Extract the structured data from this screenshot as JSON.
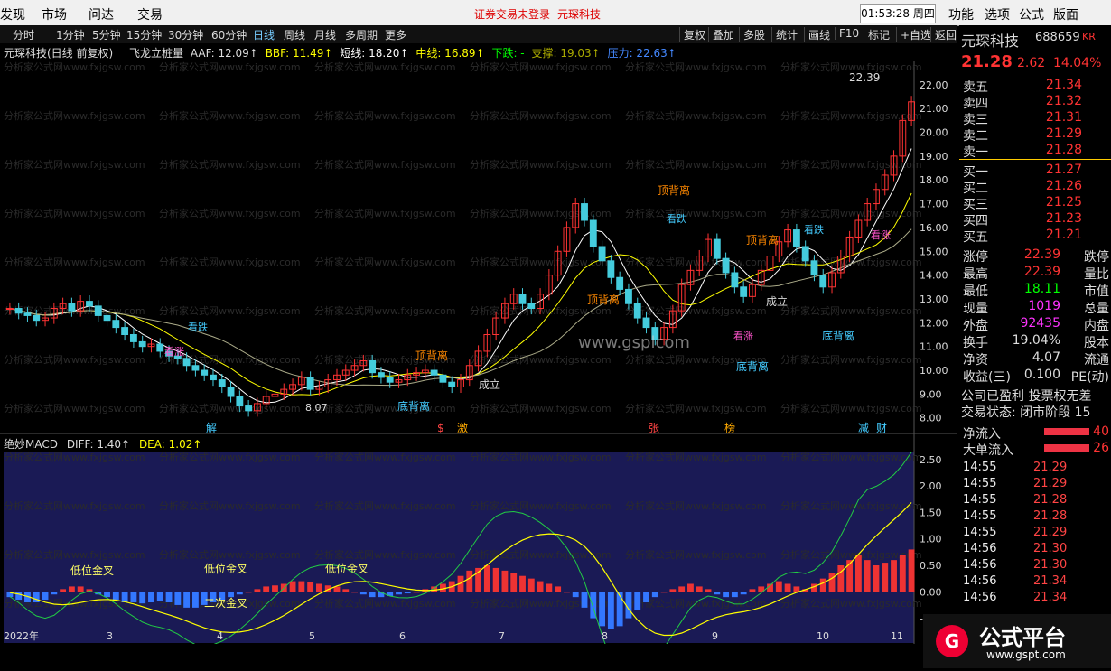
{
  "menubar": {
    "items": [
      "发现",
      "市场",
      "问达",
      "交易"
    ],
    "warning": "证券交易未登录",
    "stock_title": "元琛科技",
    "clock": "01:53:28 周四",
    "right_items": [
      "功能",
      "选项",
      "公式",
      "版面"
    ]
  },
  "toolbar": {
    "periods": [
      "分时",
      "1分钟",
      "5分钟",
      "15分钟",
      "30分钟",
      "60分钟",
      "日线",
      "周线",
      "月线",
      "多周期",
      "更多"
    ],
    "selected": "日线",
    "right_buttons": [
      "复权",
      "叠加",
      "多股",
      "统计",
      "画线",
      "F10",
      "标记",
      "+自选",
      "返回"
    ]
  },
  "main_indicator": {
    "stock_label": "元琛科技(日线 前复权)",
    "name": "飞龙立桩量",
    "aaf": "AAF: 12.09↑",
    "bbf": "BBF: 11.49↑",
    "short": "短线: 18.20↑",
    "mid": "中线: 16.89↑",
    "down": "下跌: -",
    "support": "支撑: 19.03↑",
    "pressure": "压力: 22.63↑"
  },
  "sub_indicator": {
    "name": "绝妙MACD",
    "diff": "DIFF: 1.40↑",
    "dea": "DEA: 1.02↑"
  },
  "y_axis_main": [
    "22.00",
    "21.00",
    "20.00",
    "19.00",
    "18.00",
    "17.00",
    "16.00",
    "15.00",
    "14.00",
    "13.00",
    "12.00",
    "11.00",
    "10.00",
    "9.00",
    "8.00"
  ],
  "y_axis_sub": [
    "2.50",
    "2.00",
    "1.50",
    "1.00",
    "0.50",
    "0.00",
    "-0.50"
  ],
  "x_axis": [
    "2022年",
    "3",
    "4",
    "5",
    "6",
    "7",
    "8",
    "9",
    "10",
    "11"
  ],
  "annotations": {
    "high_price": "22.39",
    "low_price": "8.07",
    "top_div": "顶背离",
    "bottom_div": "底背离",
    "fall": "看跌",
    "rise": "看涨",
    "formed": "成立",
    "low_gold": "低位金叉",
    "low_div_gold": "低位金叉",
    "second_gold": "二次金叉",
    "watermark": "分析家公式网www.fxjgsw.com",
    "site": "www.gsplcom"
  },
  "event_markers": [
    "解",
    "$",
    "激",
    "张",
    "榜",
    "减",
    "财"
  ],
  "quote": {
    "name": "元琛科技",
    "code": "688659",
    "tag": "KR",
    "price": "21.28",
    "change": "2.62",
    "pct": "14.04%"
  },
  "orderbook": {
    "sell": [
      {
        "label": "卖五",
        "price": "21.34"
      },
      {
        "label": "卖四",
        "price": "21.32"
      },
      {
        "label": "卖三",
        "price": "21.31"
      },
      {
        "label": "卖二",
        "price": "21.29"
      },
      {
        "label": "卖一",
        "price": "21.28"
      }
    ],
    "buy": [
      {
        "label": "买一",
        "price": "21.27"
      },
      {
        "label": "买二",
        "price": "21.26"
      },
      {
        "label": "买三",
        "price": "21.25"
      },
      {
        "label": "买四",
        "price": "21.23"
      },
      {
        "label": "买五",
        "price": "21.21"
      }
    ]
  },
  "stats": [
    {
      "l": "涨停",
      "v": "22.39",
      "r": "跌停"
    },
    {
      "l": "最高",
      "v": "22.39",
      "r": "量比"
    },
    {
      "l": "最低",
      "v": "18.11",
      "r": "市值"
    },
    {
      "l": "现量",
      "v": "1019",
      "r": "总量"
    },
    {
      "l": "外盘",
      "v": "92435",
      "r": "内盘"
    },
    {
      "l": "换手",
      "v": "19.04%",
      "r": "股本"
    },
    {
      "l": "净资",
      "v": "4.07",
      "r": "流通"
    },
    {
      "l": "收益(三)",
      "v": "0.100",
      "r": "PE(动)"
    }
  ],
  "status_lines": [
    "公司已盈利 投票权无差",
    "交易状态: 闭市阶段 15"
  ],
  "flows": [
    {
      "l": "净流入",
      "v": "40"
    },
    {
      "l": "大单流入",
      "v": "26"
    }
  ],
  "ticks": [
    {
      "t": "14:55",
      "p": "21.29"
    },
    {
      "t": "14:55",
      "p": "21.29"
    },
    {
      "t": "14:55",
      "p": "21.28"
    },
    {
      "t": "14:55",
      "p": "21.28"
    },
    {
      "t": "14:55",
      "p": "21.29"
    },
    {
      "t": "14:56",
      "p": "21.30"
    },
    {
      "t": "14:56",
      "p": "21.30"
    },
    {
      "t": "14:56",
      "p": "21.34"
    },
    {
      "t": "14:56",
      "p": "21.34"
    }
  ],
  "brand": {
    "name": "公式平台",
    "url": "www.gspt.com"
  },
  "chart_data": {
    "type": "candlestick",
    "price_ylim": [
      7.8,
      22.6
    ],
    "macd_ylim": [
      -0.9,
      2.6
    ],
    "closes": [
      12.6,
      12.4,
      12.3,
      12.1,
      12.2,
      12.6,
      12.8,
      12.5,
      12.9,
      12.7,
      12.3,
      12.1,
      11.8,
      11.5,
      11.2,
      11.0,
      11.1,
      10.8,
      10.6,
      10.5,
      10.2,
      10.0,
      9.8,
      9.6,
      9.3,
      8.9,
      8.5,
      8.3,
      8.6,
      8.9,
      9.0,
      9.2,
      9.4,
      9.7,
      9.2,
      9.3,
      9.6,
      9.8,
      10.0,
      10.2,
      10.4,
      9.9,
      9.7,
      9.5,
      9.6,
      9.8,
      9.9,
      10.0,
      9.8,
      9.5,
      9.3,
      9.6,
      10.2,
      10.8,
      11.5,
      12.2,
      12.8,
      13.2,
      12.8,
      12.6,
      13.2,
      14.0,
      15.0,
      16.0,
      17.0,
      16.3,
      15.2,
      14.6,
      13.9,
      13.4,
      12.8,
      12.2,
      11.8,
      11.3,
      11.8,
      12.5,
      13.6,
      14.2,
      14.8,
      15.5,
      14.7,
      14.1,
      13.5,
      13.1,
      13.6,
      14.2,
      14.8,
      15.4,
      15.9,
      15.2,
      14.6,
      14.0,
      13.5,
      14.1,
      14.8,
      15.6,
      16.3,
      17.0,
      17.6,
      18.2,
      19.0,
      20.5,
      21.28
    ],
    "macd_bars": [
      -0.1,
      -0.15,
      -0.2,
      -0.2,
      -0.15,
      -0.05,
      0.05,
      0.1,
      0.1,
      0.05,
      -0.05,
      -0.1,
      -0.15,
      -0.2,
      -0.2,
      -0.22,
      -0.2,
      -0.18,
      -0.2,
      -0.25,
      -0.3,
      -0.3,
      -0.25,
      -0.2,
      -0.15,
      -0.1,
      -0.05,
      0.0,
      0.05,
      0.1,
      0.12,
      0.15,
      0.2,
      0.2,
      0.18,
      0.15,
      0.12,
      0.1,
      0.05,
      0.0,
      -0.05,
      -0.1,
      -0.1,
      -0.08,
      -0.05,
      -0.03,
      0.0,
      0.05,
      0.1,
      0.15,
      0.2,
      0.3,
      0.4,
      0.45,
      0.5,
      0.45,
      0.4,
      0.35,
      0.3,
      0.25,
      0.2,
      0.15,
      0.1,
      0.0,
      -0.1,
      -0.3,
      -0.5,
      -0.65,
      -0.7,
      -0.65,
      -0.5,
      -0.35,
      -0.2,
      -0.1,
      0.0,
      0.05,
      0.1,
      0.15,
      0.1,
      0.05,
      -0.05,
      -0.1,
      -0.1,
      -0.05,
      0.05,
      0.1,
      0.15,
      0.2,
      0.15,
      0.1,
      0.05,
      0.15,
      0.25,
      0.35,
      0.5,
      0.6,
      0.7,
      0.6,
      0.5,
      0.55,
      0.6,
      0.7,
      0.8
    ]
  }
}
